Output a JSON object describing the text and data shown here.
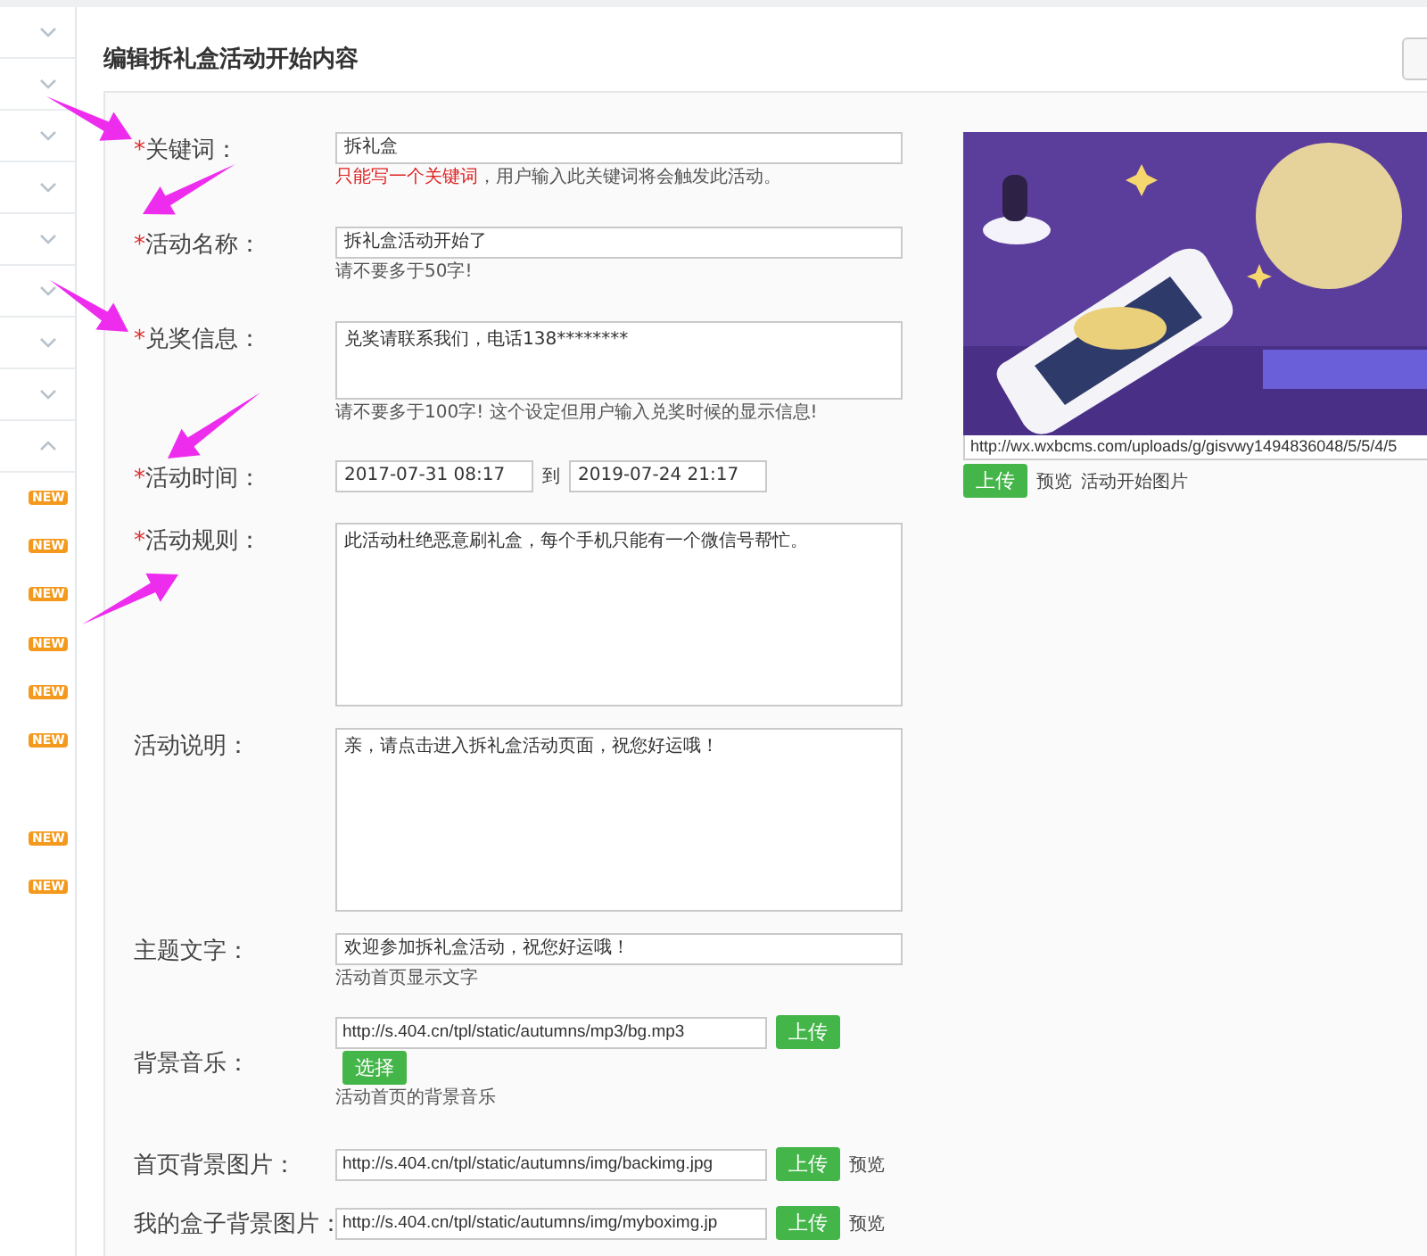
{
  "sidebar": {
    "groups": [
      {
        "expanded": false
      },
      {
        "expanded": false
      },
      {
        "expanded": false
      },
      {
        "expanded": false
      },
      {
        "expanded": false
      },
      {
        "expanded": false
      },
      {
        "expanded": false
      },
      {
        "expanded": false
      },
      {
        "expanded": true,
        "children": [
          {
            "kind": "badged",
            "badge": "NEW"
          },
          {
            "kind": "badged",
            "badge": "NEW"
          },
          {
            "kind": "badged",
            "badge": "NEW"
          },
          {
            "kind": "badged",
            "badge": "NEW"
          },
          {
            "kind": "badged",
            "badge": "NEW"
          },
          {
            "kind": "badged",
            "badge": "NEW"
          },
          {
            "kind": "plain"
          },
          {
            "kind": "badged",
            "badge": "NEW"
          },
          {
            "kind": "badged",
            "badge": "NEW"
          }
        ]
      }
    ]
  },
  "page_title": "编辑拆礼盒活动开始内容",
  "form": {
    "fields": [
      {
        "kind": "text",
        "required_mark": "*",
        "label": "关键词：",
        "value": "拆礼盒",
        "hint_warning": "只能写一个关键词",
        "hint": "，用户输入此关键词将会触发此活动。"
      },
      {
        "kind": "text",
        "required_mark": "*",
        "label": "活动名称：",
        "value": "拆礼盒活动开始了",
        "hint": "请不要多于50字!"
      },
      {
        "kind": "memo",
        "required_mark": "*",
        "label": "兑奖信息：",
        "value": "兑奖请联系我们，电话138********",
        "hint": "请不要多于100字! 这个设定但用户输入兑奖时候的显示信息!"
      },
      {
        "kind": "date_range",
        "required_mark": "*",
        "label": "活动时间：",
        "start": "2017-07-31 08:17",
        "separator": "到",
        "end": "2019-07-24 21:17"
      },
      {
        "kind": "textarea",
        "required_mark": "*",
        "label": "活动规则：",
        "value": "此活动杜绝恶意刷礼盒，每个手机只能有一个微信号帮忙。"
      },
      {
        "kind": "textarea",
        "label": "活动说明：",
        "value": "亲，请点击进入拆礼盒活动页面，祝您好运哦！"
      },
      {
        "kind": "text",
        "label": "主题文字：",
        "value": "欢迎参加拆礼盒活动，祝您好运哦！",
        "hint": "活动首页显示文字"
      },
      {
        "kind": "media",
        "label": "背景音乐：",
        "value": "http://s.404.cn/tpl/static/autumns/mp3/bg.mp3",
        "upload": "上传",
        "select": "选择",
        "hint": "活动首页的背景音乐"
      },
      {
        "kind": "upload",
        "label": "首页背景图片：",
        "value": "http://s.404.cn/tpl/static/autumns/img/backimg.jpg",
        "upload": "上传",
        "preview": "预览"
      },
      {
        "kind": "upload",
        "label": "我的盒子背景图片：",
        "value": "http://s.404.cn/tpl/static/autumns/img/myboximg.jp",
        "upload": "上传",
        "preview": "预览"
      }
    ]
  },
  "cover": {
    "url": "http://wx.wxbcms.com/uploads/g/gisvwy1494836048/5/5/4/5",
    "upload": "上传",
    "preview": "预览",
    "caption": "活动开始图片"
  }
}
